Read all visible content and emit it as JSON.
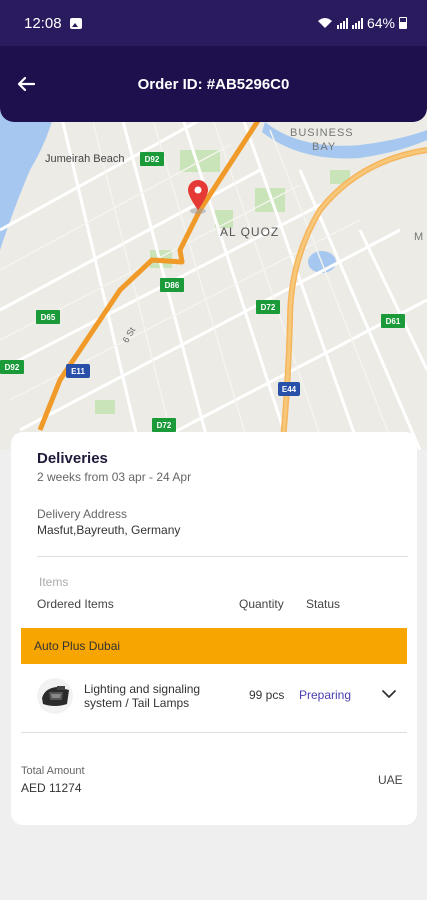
{
  "status_bar": {
    "time": "12:08",
    "battery": "64%"
  },
  "header": {
    "title": "Order ID: #AB5296C0"
  },
  "map": {
    "labels": {
      "jumeirah_beach": "Jumeirah Beach",
      "business": "BUSINESS",
      "bay": "BAY",
      "al_quoz": "AL QUOZ",
      "m": "M",
      "street": "6 St"
    },
    "shields": {
      "d92_top": "D92",
      "d86": "D86",
      "d65": "D65",
      "d72": "D72",
      "d61": "D61",
      "d92_left": "D92",
      "e11": "E11",
      "e44": "E44",
      "d72_bottom": "D72"
    }
  },
  "deliveries": {
    "title": "Deliveries",
    "schedule": "2 weeks from 03 apr - 24 Apr",
    "address_label": "Delivery Address",
    "address": "Masfut,Bayreuth, Germany"
  },
  "items": {
    "section_label": "Items",
    "col_items": "Ordered Items",
    "col_quantity": "Quantity",
    "col_status": "Status",
    "supplier": "Auto Plus Dubai",
    "product_line1": "Lighting and signaling",
    "product_line2": "system / Tail Lamps",
    "quantity": "99 pcs",
    "status": "Preparing"
  },
  "totals": {
    "label": "Total Amount",
    "amount": "AED 11274",
    "region": "UAE"
  },
  "colors": {
    "status_bar": "#2a1a5e",
    "header": "#1e0f4d",
    "supplier_bar": "#f7a500",
    "status_text": "#4a3fb0",
    "route": "#f09a2a"
  }
}
